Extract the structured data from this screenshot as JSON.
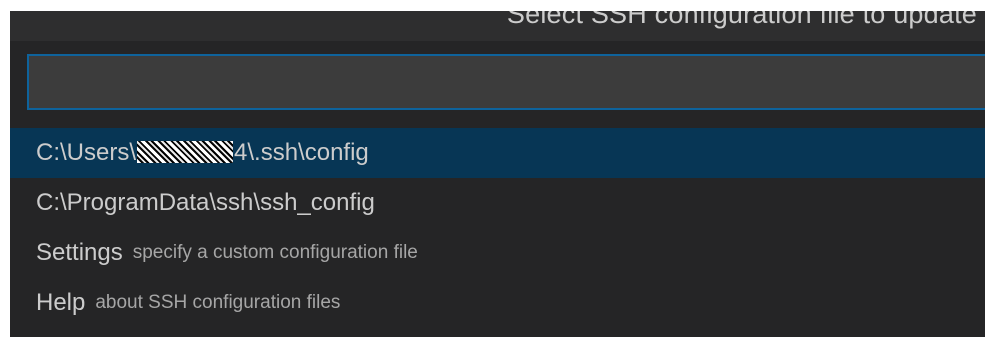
{
  "title": "Select SSH configuration file to update",
  "input": {
    "value": "",
    "placeholder": ""
  },
  "items": [
    {
      "label_prefix": "C:\\Users\\",
      "label_redacted": true,
      "label_suffix": "4\\.ssh\\config",
      "description": "",
      "selected": true
    },
    {
      "label": "C:\\ProgramData\\ssh\\ssh_config",
      "description": "",
      "selected": false
    },
    {
      "label": "Settings",
      "description": "specify a custom configuration file",
      "selected": false
    },
    {
      "label": "Help",
      "description": "about SSH configuration files",
      "selected": false
    }
  ],
  "colors": {
    "panel_background": "#252526",
    "input_border": "#0e639c",
    "selected_background": "#073655"
  }
}
